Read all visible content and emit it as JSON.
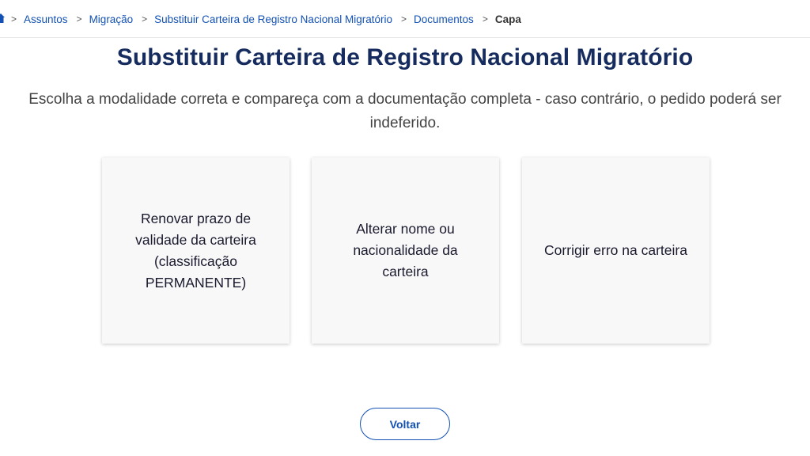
{
  "breadcrumb": {
    "home_icon": "home-icon",
    "separator": ">",
    "items": [
      {
        "label": "Assuntos"
      },
      {
        "label": "Migração"
      },
      {
        "label": "Substituir Carteira de Registro Nacional Migratório"
      },
      {
        "label": "Documentos"
      }
    ],
    "current": "Capa"
  },
  "page": {
    "title": "Substituir Carteira de Registro Nacional Migratório",
    "subtitle": "Escolha a modalidade correta e compareça com a documentação completa - caso contrário, o pedido poderá ser indeferido."
  },
  "cards": [
    {
      "label": "Renovar prazo de validade da carteira (classificação PERMANENTE)"
    },
    {
      "label": "Alterar nome ou nacionalidade da carteira"
    },
    {
      "label": "Corrigir erro na carteira"
    }
  ],
  "actions": {
    "back_label": "Voltar"
  },
  "colors": {
    "link": "#1351b4",
    "title": "#162b5e",
    "card_bg": "#f8f8f8"
  }
}
